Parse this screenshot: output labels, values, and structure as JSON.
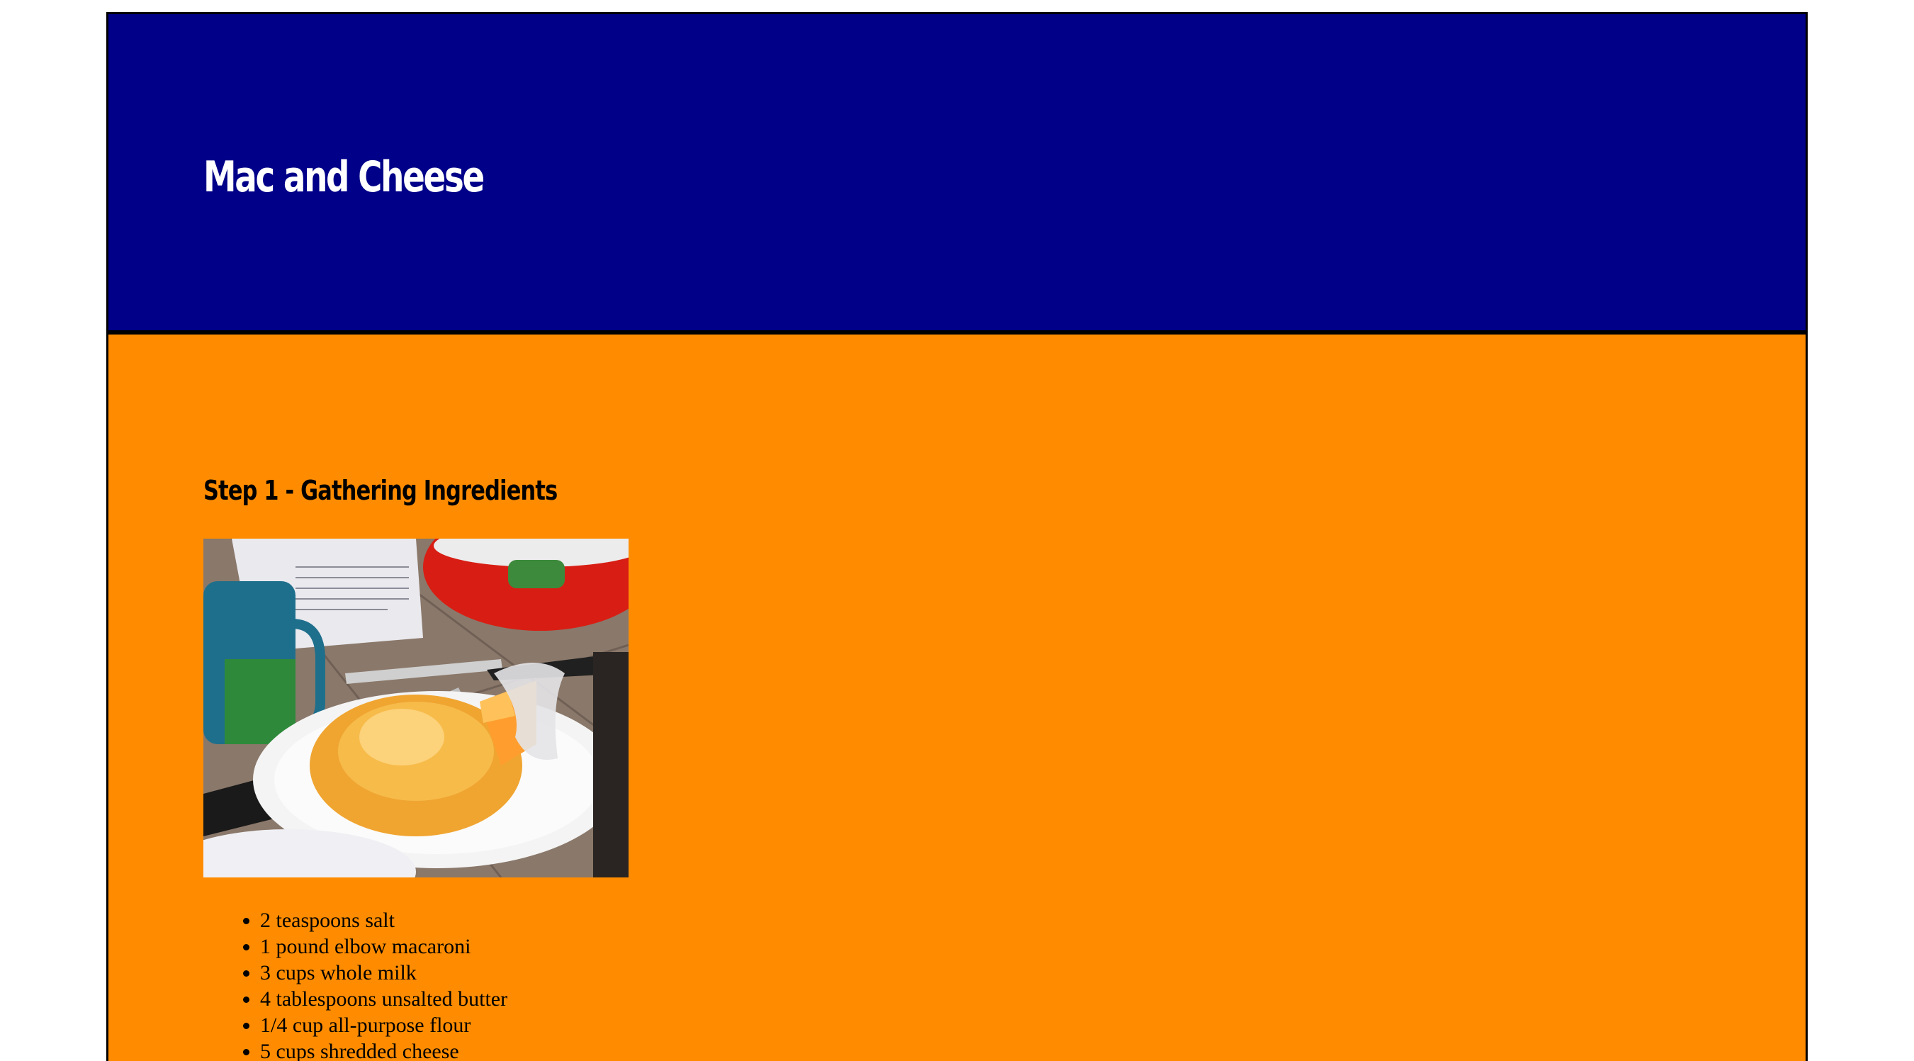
{
  "header": {
    "title": "Mac and Cheese",
    "bg_color": "#000088"
  },
  "content": {
    "bg_color": "#ff8c00",
    "step1": {
      "title": "Step 1 - Gathering Ingredients",
      "image_alt": "Shredded cheese on a paper plate next to a grater, mug and red mixing bowl",
      "ingredients": [
        "2 teaspoons salt",
        "1 pound elbow macaroni",
        "3 cups whole milk",
        "4 tablespoons unsalted butter",
        "1/4 cup all-purpose flour",
        "5 cups shredded cheese"
      ]
    }
  }
}
